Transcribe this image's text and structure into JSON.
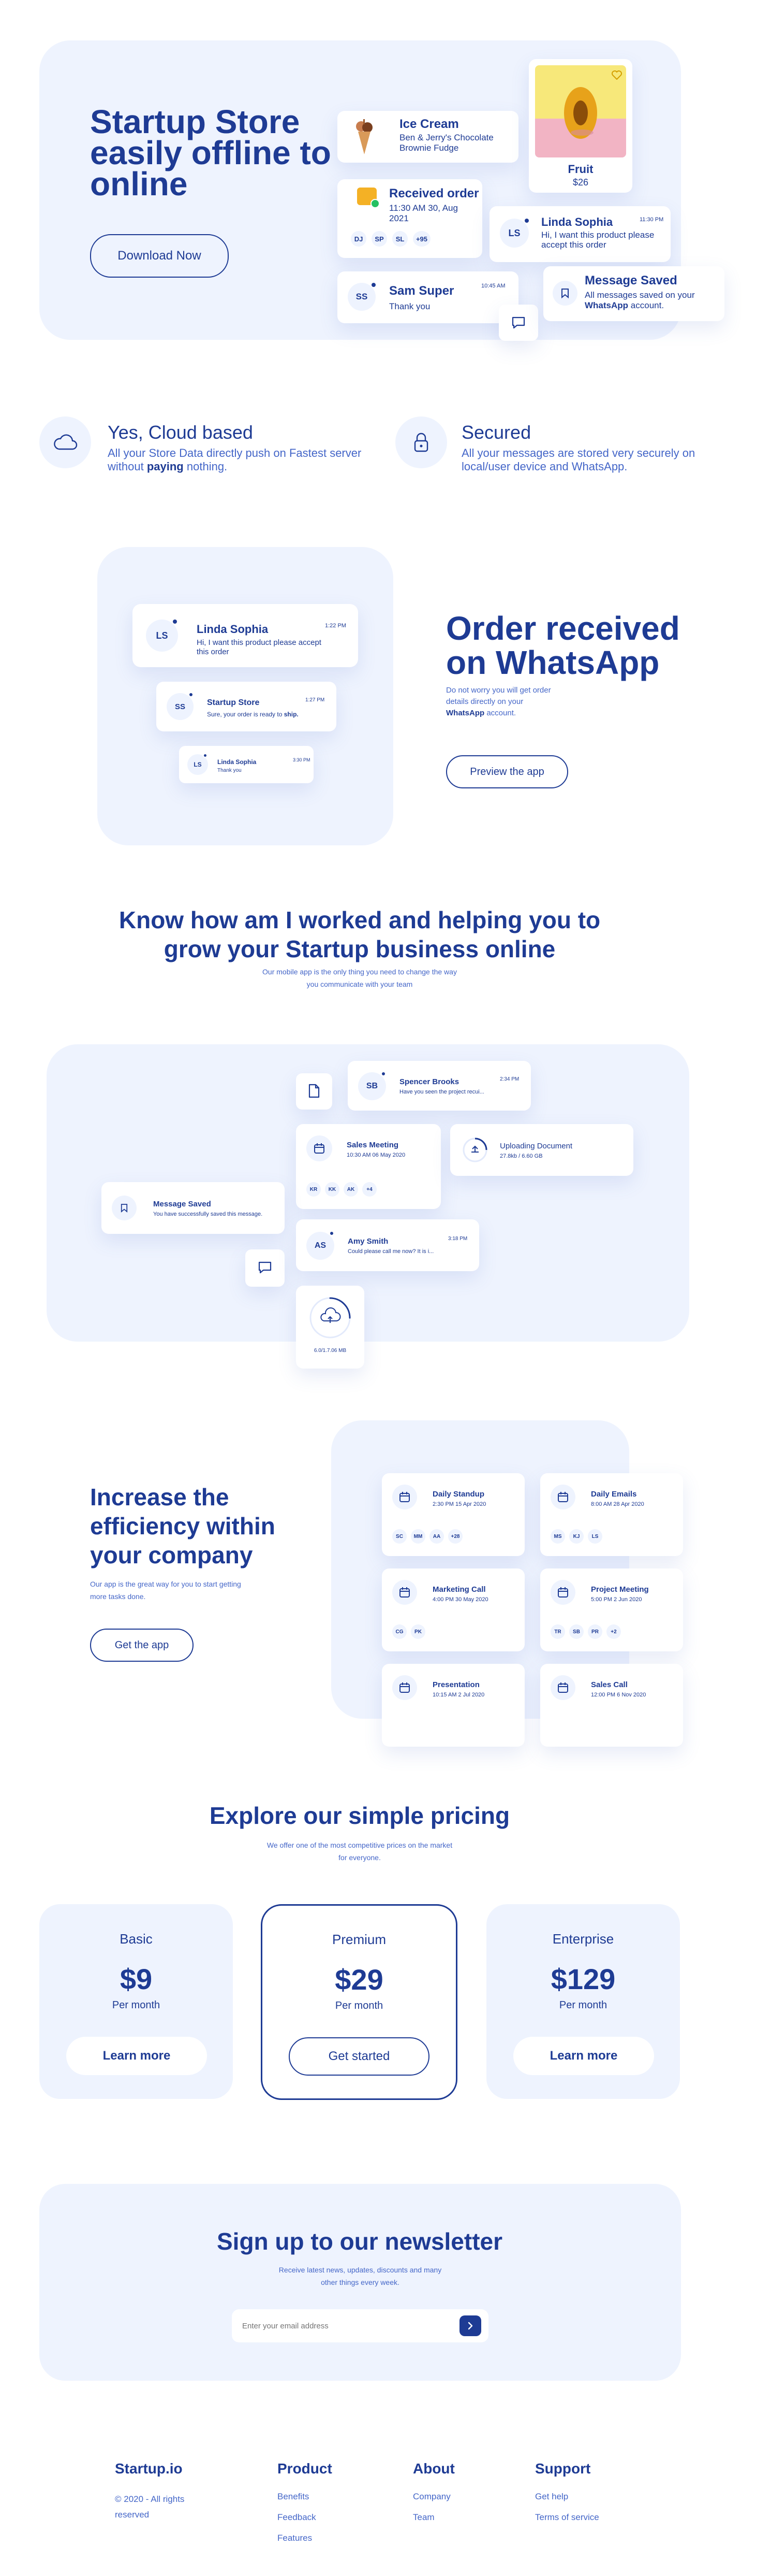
{
  "hero": {
    "title": "Startup Store easily offline to online",
    "button": "Download Now",
    "icecream": {
      "title": "Ice Cream",
      "desc": "Ben & Jerry's Chocolate Brownie Fudge"
    },
    "order": {
      "title": "Received order",
      "time": "11:30 AM 30, Aug 2021",
      "tags": [
        "DJ",
        "SP",
        "SL",
        "+95"
      ]
    },
    "fruit": {
      "name": "Fruit",
      "price": "$26"
    },
    "linda": {
      "initials": "LS",
      "name": "Linda Sophia",
      "time": "11:30 PM",
      "msg": "Hi, I want this product please accept this order"
    },
    "sam": {
      "initials": "SS",
      "name": "Sam Super",
      "time": "10:45 AM",
      "msg": "Thank you"
    },
    "saved": {
      "title": "Message Saved",
      "msg_prefix": "All messages saved on your",
      "msg_bold": "WhatsApp",
      "msg_suffix": "account."
    }
  },
  "features": [
    {
      "icon": "cloud-icon",
      "title": "Yes, Cloud based",
      "text_prefix": "All your Store Data directly push on Fastest server without",
      "text_bold": "paying",
      "text_suffix": "nothing."
    },
    {
      "icon": "lock-icon",
      "title": "Secured",
      "text": "All your messages are stored very securely on local/user device and WhatsApp."
    }
  ],
  "whatsapp": {
    "title": "Order received on WhatsApp",
    "desc_prefix": "Do not worry you will get order details directly on your",
    "desc_bold": "WhatsApp",
    "desc_suffix": "account.",
    "button": "Preview the app",
    "msgs": [
      {
        "initials": "LS",
        "name": "Linda Sophia",
        "time": "1:22 PM",
        "msg": "Hi, I want this product please accept this order"
      },
      {
        "initials": "SS",
        "name": "Startup Store",
        "time": "1:27 PM",
        "msg_prefix": "Sure, your order is ready to",
        "msg_bold": "ship."
      },
      {
        "initials": "LS",
        "name": "Linda Sophia",
        "time": "3:30 PM",
        "msg": "Thank you"
      }
    ]
  },
  "know": {
    "title": "Know how am I worked and helping you to grow your Startup business online",
    "subtitle": "Our mobile app is the only thing you need to change the way you communicate with your team"
  },
  "dashboard": {
    "spencer": {
      "initials": "SB",
      "name": "Spencer Brooks",
      "time": "2:34 PM",
      "msg": "Have you seen the project recui..."
    },
    "meeting": {
      "title": "Sales Meeting",
      "time": "10:30 AM 06 May 2020",
      "tags": [
        "KR",
        "KK",
        "AK",
        "+4"
      ]
    },
    "upload": {
      "title": "Uploading Document",
      "size": "27.8kb / 6.60 GB"
    },
    "saved": {
      "title": "Message Saved",
      "msg": "You have successfully saved this message."
    },
    "amy": {
      "initials": "AS",
      "name": "Amy Smith",
      "time": "3:18 PM",
      "msg": "Could please call me now? It is i..."
    },
    "progress": {
      "text": "6.0/1.7.06 MB",
      "fraction": 0.25
    }
  },
  "efficiency": {
    "title": "Increase the efficiency within your company",
    "desc": "Our app is the great way for you to start getting more tasks done.",
    "button": "Get the app",
    "tasks": [
      {
        "title": "Daily Standup",
        "time": "2:30 PM 15 Apr 2020",
        "tags": [
          "SC",
          "MM",
          "AA",
          "+28"
        ]
      },
      {
        "title": "Daily Emails",
        "time": "8:00 AM 28 Apr 2020",
        "tags": [
          "MS",
          "KJ",
          "LS"
        ]
      },
      {
        "title": "Marketing Call",
        "time": "4:00 PM 30 May 2020",
        "tags": [
          "CG",
          "PK"
        ]
      },
      {
        "title": "Project Meeting",
        "time": "5:00 PM 2 Jun 2020",
        "tags": [
          "TR",
          "SB",
          "PR",
          "+2"
        ]
      },
      {
        "title": "Presentation",
        "time": "10:15 AM 2 Jul 2020",
        "tags": []
      },
      {
        "title": "Sales Call",
        "time": "12:00 PM 6 Nov 2020",
        "tags": []
      }
    ]
  },
  "pricing": {
    "title": "Explore our simple pricing",
    "subtitle": "We offer one of the most competitive prices on the market for everyone.",
    "plans": [
      {
        "name": "Basic",
        "price": "$9",
        "period": "Per month",
        "button": "Learn more"
      },
      {
        "name": "Premium",
        "price": "$29",
        "period": "Per month",
        "button": "Get started"
      },
      {
        "name": "Enterprise",
        "price": "$129",
        "period": "Per month",
        "button": "Learn more"
      }
    ]
  },
  "newsletter": {
    "title": "Sign up to our newsletter",
    "subtitle": "Receive latest news, updates, discounts and many other things every week.",
    "placeholder": "Enter your email address"
  },
  "footer": {
    "brand": "Startup.io",
    "copyright": "© 2020 - All rights reserved",
    "columns": [
      {
        "title": "Product",
        "links": [
          "Benefits",
          "Feedback",
          "Features"
        ]
      },
      {
        "title": "About",
        "links": [
          "Company",
          "Team"
        ]
      },
      {
        "title": "Support",
        "links": [
          "Get help",
          "Terms of service"
        ]
      }
    ]
  },
  "colors": {
    "primary": "#1e3b94",
    "panel": "#eef3fe",
    "accent": "#4466c8"
  }
}
